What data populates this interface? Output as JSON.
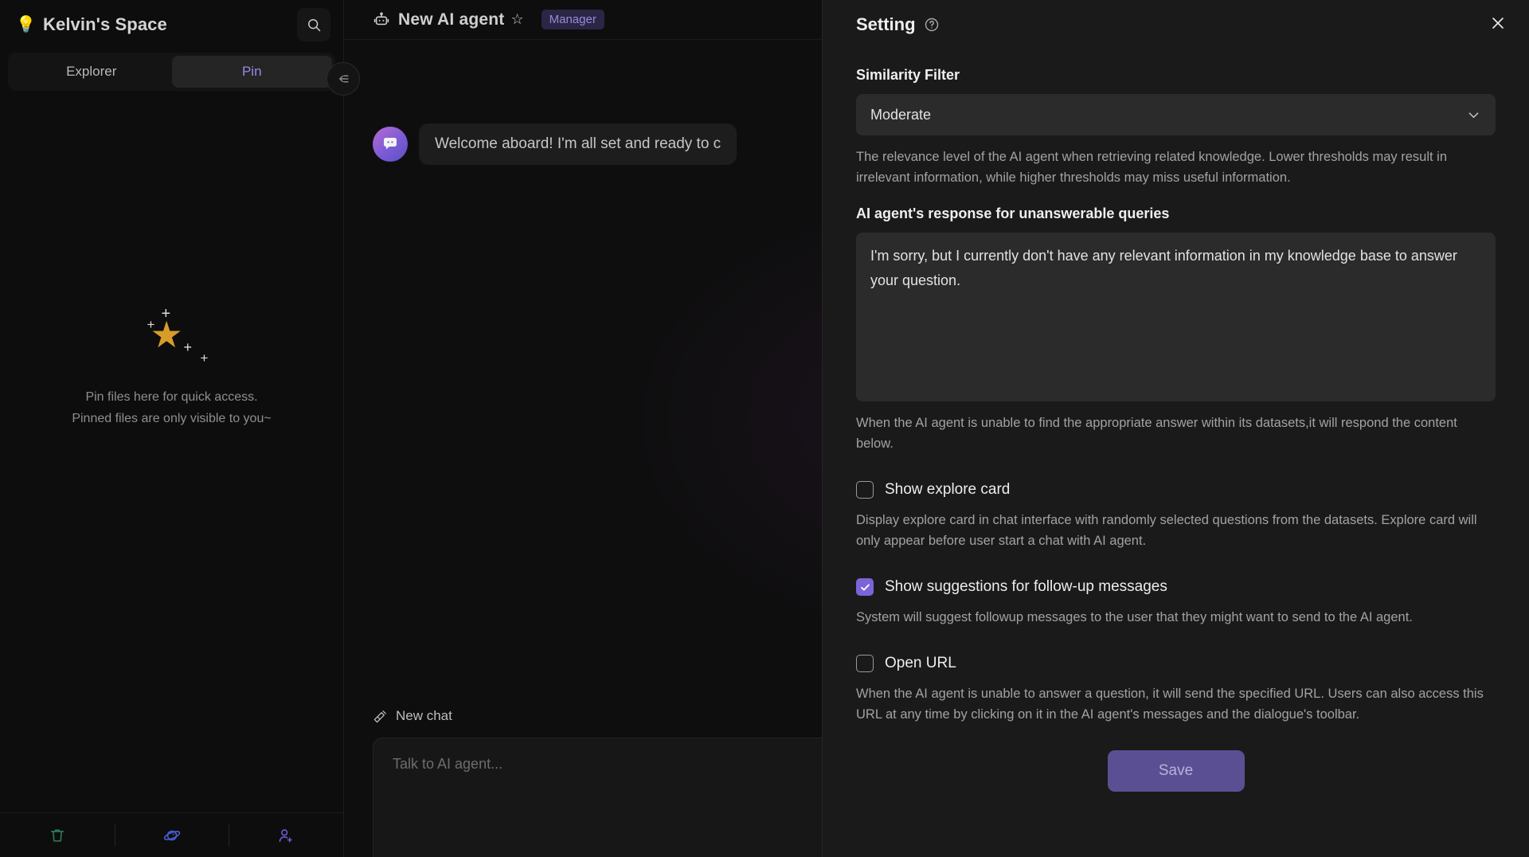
{
  "sidebar": {
    "space_title": "Kelvin's Space",
    "bulb_icon": "lightbulb-icon",
    "search_icon": "search-icon",
    "tabs": [
      {
        "label": "Explorer",
        "active": false
      },
      {
        "label": "Pin",
        "active": true
      }
    ],
    "empty_state": {
      "line1": "Pin files here for quick access.",
      "line2": "Pinned files are only visible to you~"
    },
    "footer_icons": [
      "trash-icon",
      "planet-icon",
      "add-user-icon"
    ],
    "collapse_icon": "collapse-panel-icon"
  },
  "chat": {
    "agent_icon": "robot-icon",
    "title": "New AI agent",
    "favorite_icon": "star-outline-icon",
    "role_badge": "Manager",
    "welcome_message": "Welcome aboard! I'm all set and ready to c",
    "bot_avatar_icon": "chat-bubble-icon",
    "new_chat_label": "New chat",
    "new_chat_icon": "broom-icon",
    "composer_placeholder": "Talk to AI agent..."
  },
  "setting": {
    "title": "Setting",
    "help_icon": "question-circle-icon",
    "close_icon": "close-icon",
    "similarity": {
      "label": "Similarity Filter",
      "value": "Moderate",
      "chevron_icon": "chevron-down-icon",
      "helper": "The relevance level of the AI agent when retrieving related knowledge. Lower thresholds may result in irrelevant information, while higher thresholds may miss useful information."
    },
    "unanswerable": {
      "label": "AI agent's response for unanswerable queries",
      "value": "I'm sorry, but I currently don't have any relevant information in my knowledge base to answer your question.",
      "helper": "When the AI agent is unable to find the appropriate answer within its datasets,it will respond the content below."
    },
    "explore_card": {
      "label": "Show explore card",
      "checked": false,
      "helper": "Display explore card in chat interface with randomly selected questions from the datasets. Explore card will only appear before user start a chat with AI agent."
    },
    "followup": {
      "label": "Show suggestions for follow-up messages",
      "checked": true,
      "helper": "System will suggest followup messages to the user that they might want to send to the AI agent."
    },
    "open_url": {
      "label": "Open URL",
      "checked": false,
      "helper": "When the AI agent is unable to answer a question, it will send the specified URL. Users can also access this URL at any time by clicking on it in the AI agent's messages and the dialogue's toolbar."
    },
    "save_label": "Save"
  },
  "colors": {
    "accent_purple": "#7c63d8",
    "badge_bg": "#2b2546",
    "badge_text": "#9a8ad6",
    "star_gold": "#d79c2a",
    "save_bg": "#5b4f93",
    "panel_bg": "#1a1a1a"
  }
}
